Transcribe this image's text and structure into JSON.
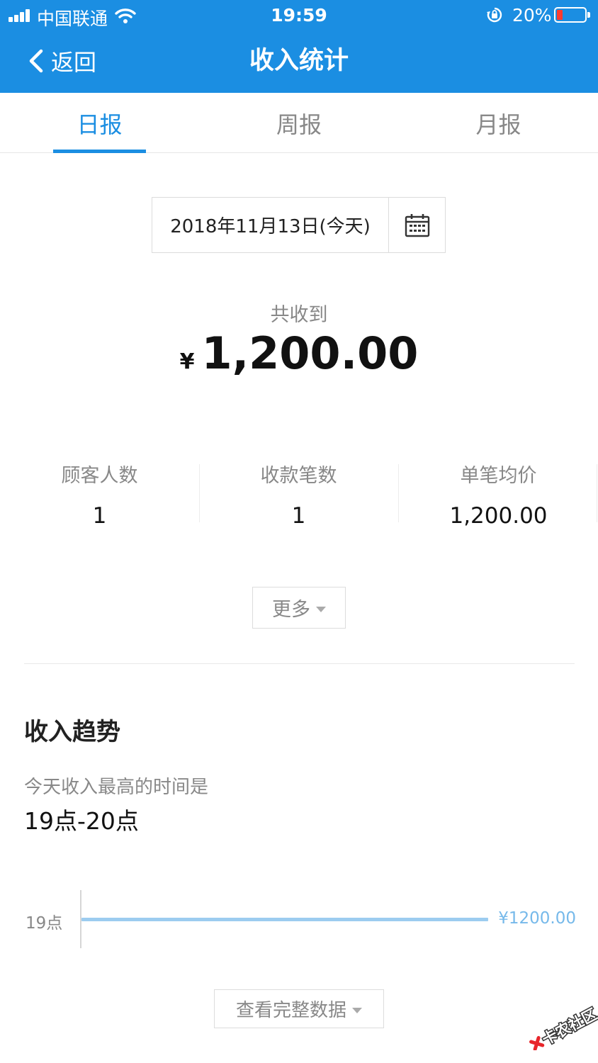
{
  "status_bar": {
    "carrier": "中国联通",
    "time": "19:59",
    "battery_percent": "20%",
    "battery_level": 0.2,
    "icons": [
      "signal-icon",
      "wifi-icon",
      "rotation-lock-icon",
      "battery-icon"
    ]
  },
  "nav": {
    "back_label": "返回",
    "title": "收入统计"
  },
  "tabs": [
    {
      "label": "日报",
      "active": true
    },
    {
      "label": "周报",
      "active": false
    },
    {
      "label": "月报",
      "active": false
    }
  ],
  "date_picker": {
    "value": "2018年11月13日(今天)",
    "icon": "calendar-icon"
  },
  "summary": {
    "label": "共收到",
    "currency": "¥",
    "amount": "1,200.00"
  },
  "stats": [
    {
      "label": "顾客人数",
      "value": "1"
    },
    {
      "label": "收款笔数",
      "value": "1"
    },
    {
      "label": "单笔均价",
      "value": "1,200.00"
    }
  ],
  "more_button": {
    "label": "更多"
  },
  "trend": {
    "title": "收入趋势",
    "peak_label": "今天收入最高的时间是",
    "peak_value": "19点-20点",
    "rows": [
      {
        "hour": "19点",
        "value": 1200,
        "value_label": "¥1200.00",
        "fraction": 1.0
      }
    ]
  },
  "full_data_button": {
    "label": "查看完整数据"
  },
  "watermark": {
    "text": "卡农社区"
  },
  "colors": {
    "brand": "#1b8ee2",
    "bar": "#9cccf0",
    "bar_label": "#76b9ea",
    "muted_text": "#888888"
  }
}
